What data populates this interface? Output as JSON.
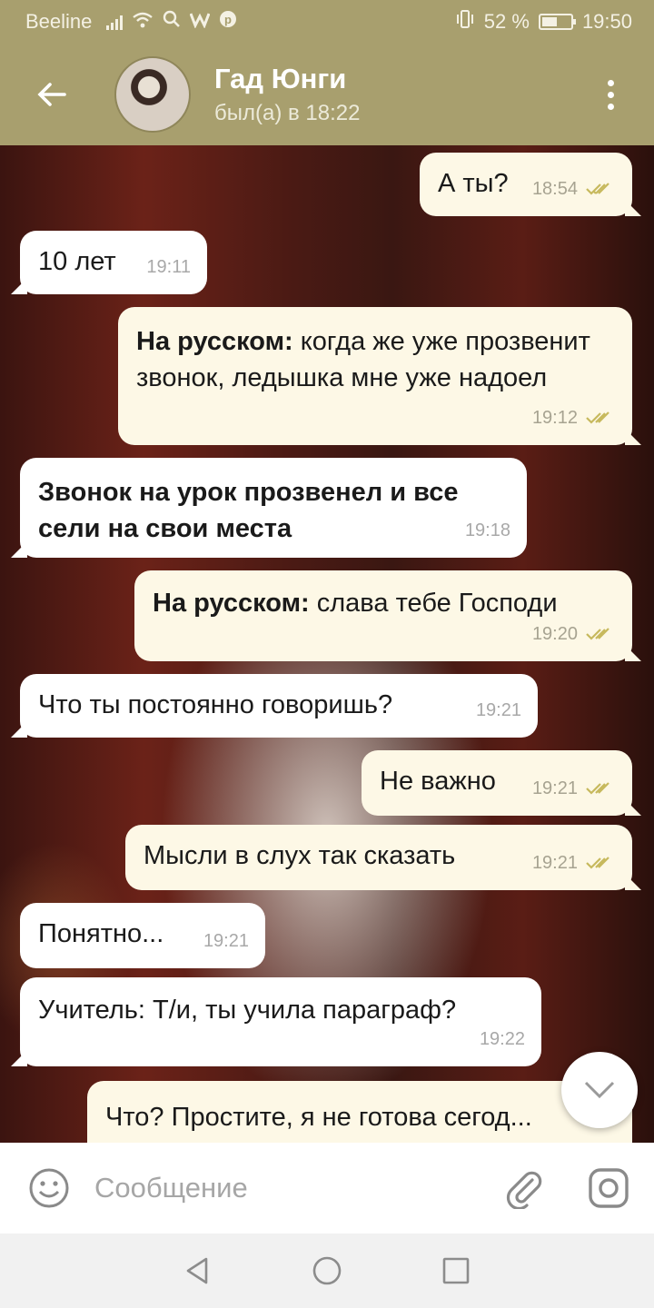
{
  "status_bar": {
    "carrier": "Beeline",
    "battery_percent_text": "52 %",
    "battery_level": 0.52,
    "time": "19:50"
  },
  "header": {
    "contact_name": "Гад Юнги",
    "last_seen": "был(а) в 18:22"
  },
  "messages": [
    {
      "direction": "out",
      "text": "А ты?",
      "time": "18:54",
      "read": true
    },
    {
      "direction": "in",
      "text": "10 лет",
      "time": "19:11"
    },
    {
      "direction": "out",
      "bold_prefix": "На русском:",
      "text": " когда же уже прозвенит звонок, ледышка мне уже надоел",
      "time": "19:12",
      "read": true
    },
    {
      "direction": "in",
      "bold_text": "Звонок на урок прозвенел и все сели на свои места",
      "time": "19:18"
    },
    {
      "direction": "out",
      "bold_prefix": "На русском:",
      "text": " слава тебе Господи",
      "time": "19:20",
      "read": true
    },
    {
      "direction": "in",
      "text": "Что ты постоянно говоришь?",
      "time": "19:21"
    },
    {
      "direction": "out",
      "text": "Не важно",
      "time": "19:21",
      "read": true
    },
    {
      "direction": "out",
      "text": "Мысли в слух так сказать",
      "time": "19:21",
      "read": true
    },
    {
      "direction": "in",
      "text": "Понятно...",
      "time": "19:21"
    },
    {
      "direction": "in",
      "text": "Учитель: Т/и, ты учила параграф?",
      "time": "19:22"
    },
    {
      "direction": "out",
      "text": "Что? Простите, я не готова сегод...",
      "time": ""
    }
  ],
  "composer": {
    "placeholder": "Сообщение"
  },
  "colors": {
    "header_bg": "#a89f6e",
    "outgoing_bubble": "#fdf8e6",
    "incoming_bubble": "#ffffff",
    "read_tick": "#c7b95d"
  },
  "icons": [
    "back-arrow-icon",
    "more-vert-icon",
    "chevron-down-icon",
    "emoji-icon",
    "attach-icon",
    "instagram-camera-icon",
    "nav-back-icon",
    "nav-home-icon",
    "nav-recents-icon"
  ]
}
